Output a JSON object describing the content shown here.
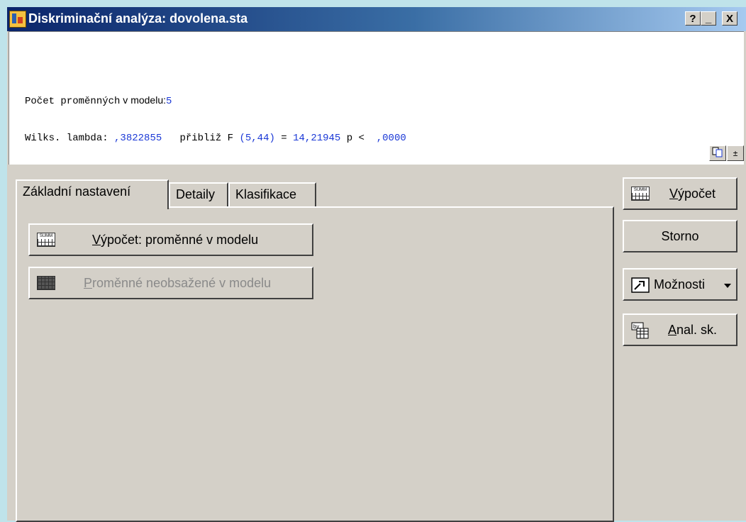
{
  "window": {
    "title": "Diskriminační analýza: dovolena.sta",
    "controls": {
      "help": "?",
      "minimize": "_",
      "close": "X"
    }
  },
  "output": {
    "line1": {
      "label_mono": "Počet proměnných",
      "label_sans": " v modelu:",
      "value": "5"
    },
    "line2": {
      "label": "Wilks. lambda: ",
      "lambda": ",3822855",
      "mid": "   přibliž F ",
      "df": "(5,44)",
      "eq": " = ",
      "f": "14,21945",
      "p_label": " p <  ",
      "p": ",0000"
    },
    "icons": {
      "copy": "copy-icon",
      "scroll": "±"
    }
  },
  "tabs": [
    {
      "label": "Základní nastavení",
      "active": true
    },
    {
      "label": "Detaily",
      "active": false
    },
    {
      "label": "Klasifikace",
      "active": false
    }
  ],
  "panel": {
    "compute_model": {
      "mnemonic": "V",
      "rest": "ýpočet:  proměnné v modelu"
    },
    "not_in_model": {
      "mnemonic": "P",
      "rest": "roměnné neobsažené v modelu"
    }
  },
  "side": {
    "compute": {
      "mnemonic": "V",
      "rest": "ýpočet"
    },
    "cancel": "Storno",
    "options": "Možnosti",
    "group": {
      "mnemonic": "A",
      "rest": "nal. sk."
    }
  },
  "colors": {
    "accent_blue": "#1a38d6",
    "title_dark": "#0a246a",
    "face": "#d4d0c8"
  }
}
